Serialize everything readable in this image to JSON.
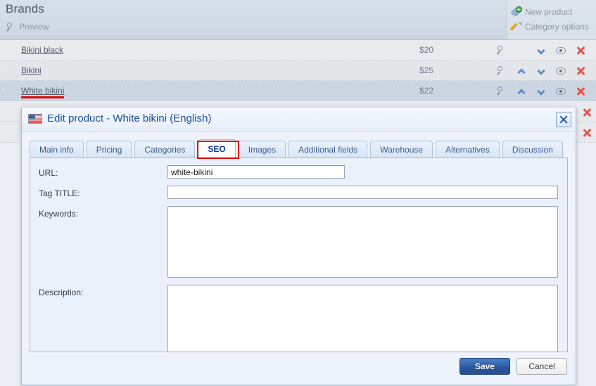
{
  "header": {
    "title": "Brands",
    "preview_label": "Preview",
    "preview_icon": "magnifier-icon"
  },
  "actions": [
    {
      "label": "New product",
      "icon": "new-product-tag-icon"
    },
    {
      "label": "Category options",
      "icon": "pencil-edit-icon"
    }
  ],
  "product_list": {
    "rows": [
      {
        "name": "Bikini black",
        "price": "$20",
        "icon": "tag-icon",
        "highlighted": false,
        "has_move_up": false,
        "has_move_down": true
      },
      {
        "name": "Bikini",
        "price": "$25",
        "icon": "tag-icon",
        "highlighted": false,
        "has_move_up": true,
        "has_move_down": true
      },
      {
        "name": "White bikini",
        "price": "$22",
        "icon": "tag-icon",
        "highlighted": true,
        "has_move_up": true,
        "has_move_down": true
      }
    ],
    "row_action_icons": [
      "magnifier-icon",
      "move-up-icon",
      "move-down-icon",
      "preview-eye-icon",
      "delete-icon"
    ]
  },
  "modal": {
    "title": "Edit product - White bikini (English)",
    "flag_icon": "us-flag-icon",
    "close_icon": "close-icon",
    "tabs": [
      {
        "label": "Main info",
        "active": false
      },
      {
        "label": "Pricing",
        "active": false
      },
      {
        "label": "Categories",
        "active": false
      },
      {
        "label": "SEO",
        "active": true,
        "annotated": true
      },
      {
        "label": "Images",
        "active": false
      },
      {
        "label": "Additional fields",
        "active": false
      },
      {
        "label": "Warehouse",
        "active": false
      },
      {
        "label": "Alternatives",
        "active": false
      },
      {
        "label": "Discussion",
        "active": false
      }
    ],
    "fields": {
      "url": {
        "label": "URL:",
        "value": "white-bikini",
        "placeholder": ""
      },
      "tag_title": {
        "label": "Tag TITLE:",
        "value": "",
        "placeholder": ""
      },
      "keywords": {
        "label": "Keywords:",
        "value": "",
        "placeholder": ""
      },
      "description": {
        "label": "Description:",
        "value": "",
        "placeholder": ""
      }
    },
    "buttons": {
      "save": "Save",
      "cancel": "Cancel"
    }
  },
  "colors": {
    "accent_blue": "#2f5fa8",
    "annotation_red": "#e00000",
    "delete_red": "#e8534a",
    "modal_bg": "#eef3fb",
    "header_bg": "#d2dbe6"
  }
}
